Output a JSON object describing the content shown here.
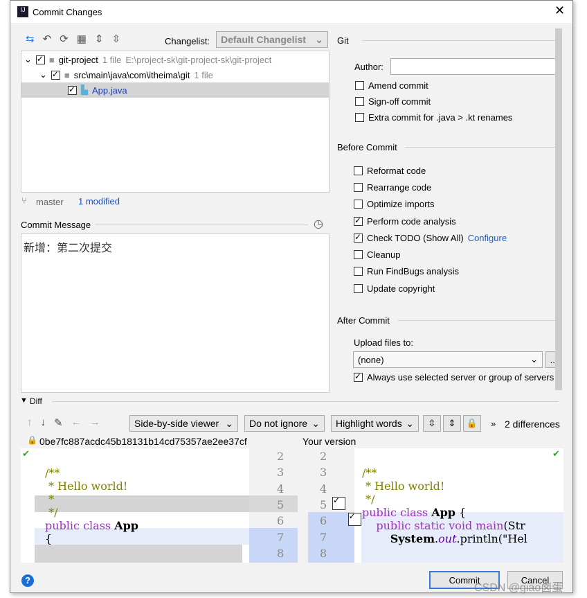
{
  "window": {
    "title": "Commit Changes"
  },
  "toolbar": {
    "changelist_label": "Changelist:",
    "changelist_value": "Default Changelist"
  },
  "tree": [
    {
      "name": "git-project",
      "count": "1 file",
      "path": "E:\\project-sk\\git-project-sk\\git-project"
    },
    {
      "name": "src\\main\\java\\com\\itheima\\git",
      "count": "1 file"
    },
    {
      "name": "App.java"
    }
  ],
  "status": {
    "branch": "master",
    "modified": "1 modified"
  },
  "commit_message": {
    "label": "Commit Message",
    "value": "新增：第二次提交"
  },
  "git": {
    "section": "Git",
    "author_label": "Author:",
    "author_value": "",
    "options": [
      "Amend commit",
      "Sign-off commit",
      "Extra commit for .java > .kt renames"
    ]
  },
  "before_commit": {
    "section": "Before Commit",
    "options": [
      {
        "label": "Reformat code",
        "checked": false
      },
      {
        "label": "Rearrange code",
        "checked": false
      },
      {
        "label": "Optimize imports",
        "checked": false
      },
      {
        "label": "Perform code analysis",
        "checked": true
      },
      {
        "label": "Check TODO (Show All)",
        "checked": true,
        "link": "Configure"
      },
      {
        "label": "Cleanup",
        "checked": false
      },
      {
        "label": "Run FindBugs analysis",
        "checked": false
      },
      {
        "label": "Update copyright",
        "checked": false
      }
    ]
  },
  "after_commit": {
    "section": "After Commit",
    "upload_label": "Upload files to:",
    "upload_value": "(none)",
    "browse": "...",
    "always_label": "Always use selected server or group of servers"
  },
  "diff": {
    "label": "Diff",
    "viewer": "Side-by-side viewer",
    "ignore": "Do not ignore",
    "highlight": "Highlight words",
    "differences": "2 differences",
    "left_title": "0be7fc887acdc45b18131b14cd75357ae2ee37cf",
    "right_title": "Your version",
    "line_numbers": [
      "2",
      "3",
      "4",
      "5",
      "6",
      "7",
      "8"
    ]
  },
  "buttons": {
    "commit": "Commit",
    "cancel": "Cancel"
  },
  "watermark": "CSDN @giao卤蛋"
}
